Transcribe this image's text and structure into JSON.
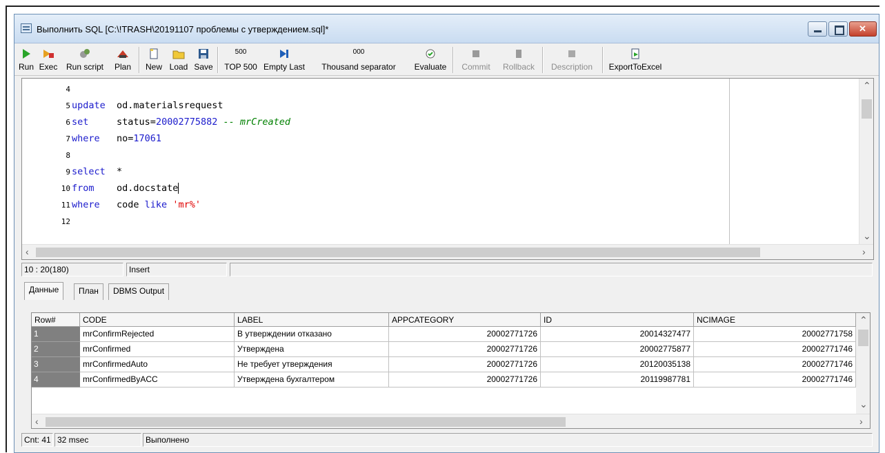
{
  "window": {
    "title": "Выполнить SQL [C:\\!TRASH\\20191107 проблемы с утверждением.sql]*"
  },
  "toolbar": {
    "run": "Run",
    "exec": "Exec",
    "run_script": "Run script",
    "plan": "Plan",
    "new": "New",
    "load": "Load",
    "save": "Save",
    "top500_icon": "500",
    "top500": "TOP 500",
    "empty_last": "Empty Last",
    "thousand_icon": "000",
    "thousand_separator": "Thousand separator",
    "evaluate": "Evaluate",
    "commit": "Commit",
    "rollback": "Rollback",
    "description": "Description",
    "export": "ExportToExcel"
  },
  "editor": {
    "line_numbers": [
      "4",
      "5",
      "6",
      "7",
      "8",
      "9",
      "10",
      "11",
      "12"
    ],
    "lines": {
      "l5_kw": "update",
      "l5_rest": "  od.materialsrequest",
      "l6_kw": "set",
      "l6_a": "     status=",
      "l6_num": "20002775882",
      "l6_cmt": " -- mrCreated",
      "l7_kw": "where",
      "l7_a": "   no=",
      "l7_num": "17061",
      "l9_kw": "select",
      "l9_rest": "  *",
      "l10_kw": "from",
      "l10_rest": "    od.docstate",
      "l11_kw": "where",
      "l11_a": "   code ",
      "l11_kw2": "like",
      "l11_str": " 'mr%'"
    }
  },
  "status": {
    "position": "10 : 20(180)",
    "mode": "Insert"
  },
  "tabs": [
    "Данные",
    "План",
    "DBMS Output"
  ],
  "grid": {
    "columns": [
      "Row#",
      "CODE",
      "LABEL",
      "APPCATEGORY",
      "ID",
      "NCIMAGE"
    ],
    "rows": [
      {
        "num": "1",
        "code": "mrConfirmRejected",
        "label": "В утверждении отказано",
        "appcategory": "20002771726",
        "id": "20014327477",
        "ncimage": "20002771758"
      },
      {
        "num": "2",
        "code": "mrConfirmed",
        "label": "Утверждена",
        "appcategory": "20002771726",
        "id": "20002775877",
        "ncimage": "20002771746"
      },
      {
        "num": "3",
        "code": "mrConfirmedAuto",
        "label": "Не требует утверждения",
        "appcategory": "20002771726",
        "id": "20120035138",
        "ncimage": "20002771746"
      },
      {
        "num": "4",
        "code": "mrConfirmedByACC",
        "label": "Утверждена бухгалтером",
        "appcategory": "20002771726",
        "id": "20119987781",
        "ncimage": "20002771746"
      }
    ]
  },
  "bottom_status": {
    "count": "Cnt: 41",
    "time": "32 msec",
    "result": "Выполнено"
  }
}
